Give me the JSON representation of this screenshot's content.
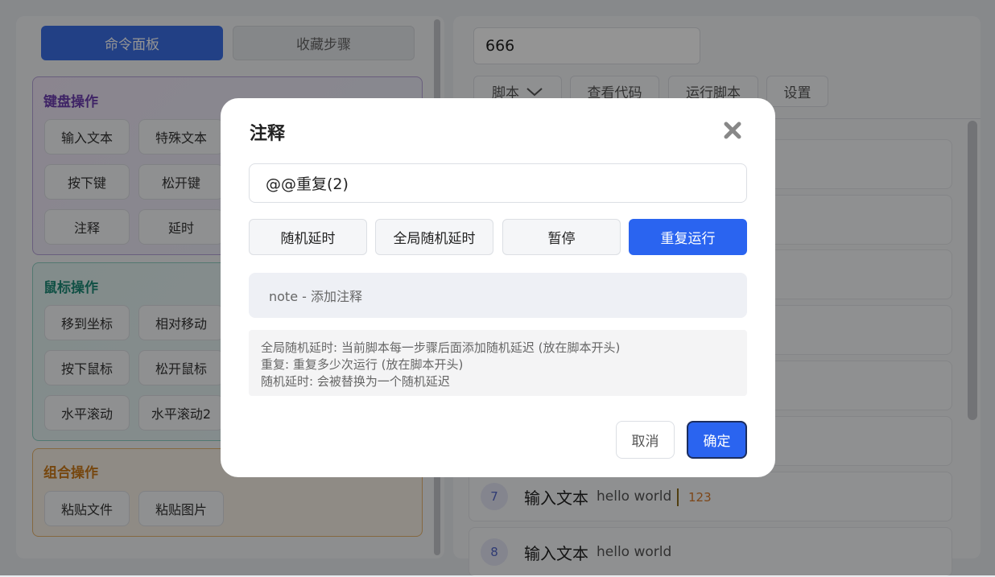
{
  "left": {
    "tabs": [
      {
        "label": "命令面板"
      },
      {
        "label": "收藏步骤"
      }
    ],
    "groups": [
      {
        "title": "键盘操作",
        "buttons": [
          "输入文本",
          "特殊文本",
          "按下键",
          "松开键",
          "注释",
          "延时"
        ]
      },
      {
        "title": "鼠标操作",
        "buttons": [
          "移到坐标",
          "相对移动",
          "按下鼠标",
          "松开鼠标",
          "水平滚动",
          "水平滚动2"
        ]
      },
      {
        "title": "组合操作",
        "buttons": [
          "粘贴文件",
          "粘贴图片"
        ]
      }
    ]
  },
  "right": {
    "script_name": "666",
    "toolbar": [
      {
        "label": "脚本"
      },
      {
        "label": "查看代码"
      },
      {
        "label": "运行脚本"
      },
      {
        "label": "设置"
      }
    ],
    "steps": [
      {
        "num": "7",
        "cmd": "输入文本",
        "arg": "hello world",
        "extra": "123"
      },
      {
        "num": "8",
        "cmd": "输入文本",
        "arg": "hello world",
        "extra": ""
      }
    ]
  },
  "dialog": {
    "title": "注释",
    "close_icon": "close-icon",
    "input_value": "@@重复(2)",
    "options": [
      {
        "label": "随机延时",
        "active": false
      },
      {
        "label": "全局随机延时",
        "active": false
      },
      {
        "label": "暂停",
        "active": false
      },
      {
        "label": "重复运行",
        "active": true
      }
    ],
    "hint": "note - 添加注释",
    "help_lines": [
      "全局随机延时: 当前脚本每一步骤后面添加随机延迟 (放在脚本开头)",
      "重复: 重复多少次运行 (放在脚本开头)",
      "随机延时: 会被替换为一个随机延迟"
    ],
    "cancel_label": "取消",
    "ok_label": "确定"
  }
}
